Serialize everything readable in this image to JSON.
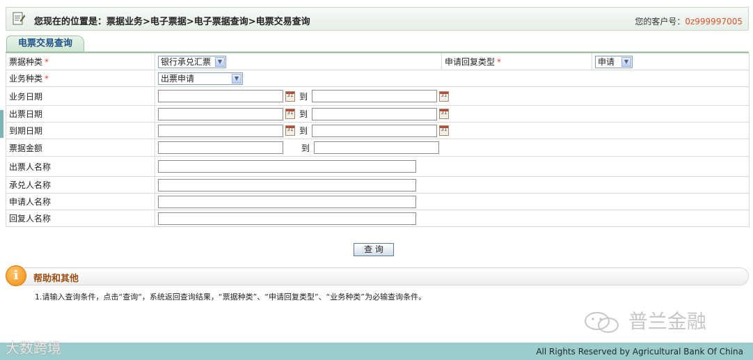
{
  "header": {
    "breadcrumb": "您现在的位置是：票据业务>电子票据>电子票据查询>电票交易查询",
    "customer_label": "您的客户号：",
    "customer_number": "0z999997005"
  },
  "tab": {
    "label": "电票交易查询"
  },
  "form": {
    "bill_type_label": "票据种类",
    "bill_type_value": "银行承兑汇票",
    "reply_type_label": "申请回复类型",
    "reply_type_value": "申请",
    "business_type_label": "业务种类",
    "business_type_value": "出票申请",
    "business_date_label": "业务日期",
    "issue_date_label": "出票日期",
    "due_date_label": "到期日期",
    "amount_label": "票据金额",
    "drawer_label": "出票人名称",
    "acceptor_label": "承兑人名称",
    "applicant_label": "申请人名称",
    "replier_label": "回复人名称",
    "to_label": "到",
    "required_mark": "*",
    "calendar_text": "31"
  },
  "query_button": {
    "label": "查 询"
  },
  "help": {
    "title": "帮助和其他",
    "icon_glyph": "i",
    "text": "1.请输入查询条件，点击“查询“，系统返回查询结果，“票据种类”、“申请回复类型”、“业务种类”为必输查询条件。"
  },
  "watermark": {
    "text": "普兰金融",
    "text2": "大数跨境"
  },
  "footer": {
    "copyright": "All Rights Reserved by Agricultural Bank Of China"
  },
  "colors": {
    "accent_green": "#9fc2a3",
    "footer_teal": "#9ccccc",
    "customer_number": "#d9532a",
    "required": "#e03a3a"
  },
  "icons": [
    "document-icon",
    "calendar-icon",
    "dropdown-arrow-icon",
    "info-icon",
    "wechat-icon"
  ]
}
